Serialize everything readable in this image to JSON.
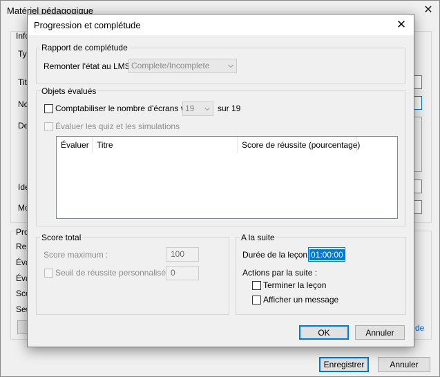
{
  "background_window": {
    "title": "Matériel pédagogique",
    "close_glyph": "✕",
    "labels": {
      "info": "Info",
      "type": "Typ",
      "titre": "Titr",
      "nom": "Nor",
      "desc": "Des",
      "ide": "Ide",
      "mo": "Mo",
      "proc": "Proc",
      "rem": "Rem",
      "eva1": "Éva",
      "eva2": "Éva",
      "sco": "Sco",
      "seu": "Seu"
    },
    "link_fragment": "de",
    "save_label": "Enregistrer",
    "cancel_label": "Annuler"
  },
  "dialog": {
    "title": "Progression et complétude",
    "close_glyph": "✕",
    "completion_report": {
      "legend": "Rapport de complétude",
      "lms_label": "Remonter l'état au LMS :",
      "lms_value": "Complete/Incomplete"
    },
    "evaluated_objects": {
      "legend": "Objets évalués",
      "count_screens_label": "Comptabiliser le nombre d'écrans vus :",
      "screens_value": "19",
      "screens_total": "sur 19",
      "evaluate_quiz_label": "Évaluer les quiz et les simulations",
      "columns": [
        "Évaluer",
        "Titre",
        "Score de réussite (pourcentage)"
      ]
    },
    "total_score": {
      "legend": "Score total",
      "max_score_label": "Score maximum :",
      "max_score_value": "100",
      "custom_threshold_label": "Seuil de réussite personnalisé :",
      "custom_threshold_value": "0"
    },
    "next": {
      "legend": "A la suite",
      "duration_label": "Durée de la leçon :",
      "duration_value": "01:00:00",
      "actions_label": "Actions par la suite :",
      "finish_lesson_label": "Terminer la leçon",
      "show_message_label": "Afficher un message"
    },
    "ok_label": "OK",
    "cancel_label": "Annuler"
  },
  "icons": {
    "chevron": "chevron-down-icon",
    "close": "close-icon"
  }
}
